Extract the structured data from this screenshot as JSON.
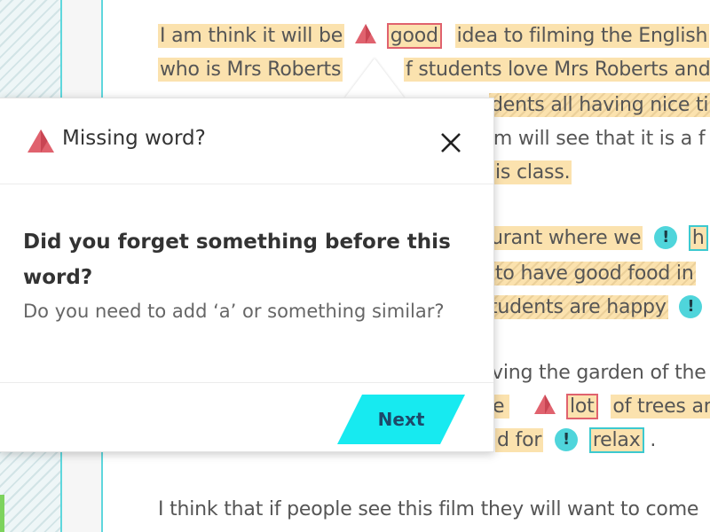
{
  "colors": {
    "accent_cyan": "#17eaf0",
    "warning_red": "#e0626e",
    "highlight_yellow": "#fbe2ae",
    "text_dark": "#333333"
  },
  "essay": {
    "line1": {
      "a": "I am think it will be",
      "b": "good",
      "c": "idea to filming the English"
    },
    "line2": {
      "a": "who is Mrs Roberts",
      "b": "f students love Mrs Roberts and"
    },
    "line3": {
      "a": "dents all having nice tim"
    },
    "line4": {
      "a": "lm will see that it is a f"
    },
    "line5": {
      "a": "is class."
    },
    "line6": {
      "a": "urant where we",
      "b": "h"
    },
    "line7": {
      "a": "to have good food in"
    },
    "line8": {
      "a": "tudents are happy"
    },
    "line9": {
      "a": "ving the garden of the"
    },
    "line10": {
      "a": "e",
      "b": "lot",
      "c": "of trees and"
    },
    "line11": {
      "a": "d for",
      "b": "relax",
      "c": "."
    },
    "line12": {
      "a": "I think that if people see this film they will want to come"
    },
    "exclamation": "!"
  },
  "popup": {
    "icon": "warning-triangle-icon",
    "title": "Missing word?",
    "close_icon": "close-icon",
    "question": "Did you forget something before this word?",
    "hint": "Do you need to add ‘a’ or something similar?",
    "next_label": "Next"
  }
}
